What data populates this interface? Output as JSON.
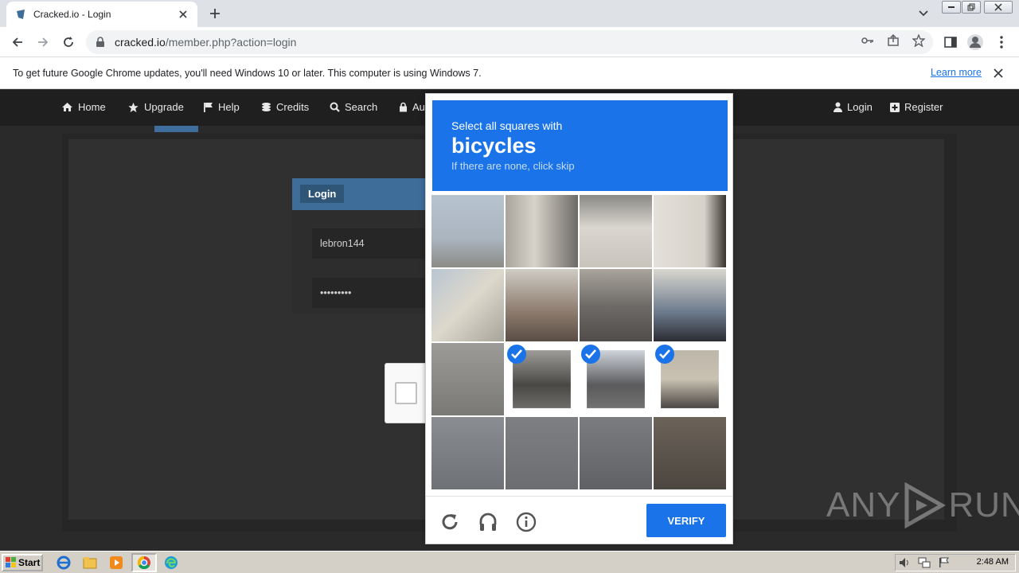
{
  "browser": {
    "tab_title": "Cracked.io - Login",
    "url_host": "cracked.io",
    "url_path": "/member.php?action=login"
  },
  "infobar": {
    "message": "To get future Google Chrome updates, you'll need Windows 10 or later. This computer is using Windows 7.",
    "learn_more": "Learn more"
  },
  "site": {
    "nav": [
      {
        "label": "Home",
        "icon": "home-icon"
      },
      {
        "label": "Upgrade",
        "icon": "star-icon"
      },
      {
        "label": "Help",
        "icon": "flag-icon"
      },
      {
        "label": "Credits",
        "icon": "coins-icon"
      },
      {
        "label": "Search",
        "icon": "search-icon"
      },
      {
        "label": "Au",
        "icon": "lock-icon"
      }
    ],
    "nav_right": [
      {
        "label": "Login",
        "icon": "user-icon"
      },
      {
        "label": "Register",
        "icon": "plus-square-icon"
      }
    ],
    "login_title": "Login",
    "username_value": "lebron144",
    "password_value": "•••••••••"
  },
  "captcha": {
    "instruction": "Select all squares with",
    "target": "bicycles",
    "hint": "If there are none, click skip",
    "selected_tiles": [
      9,
      10,
      11
    ],
    "verify_label": "VERIFY",
    "accent": "#1a73e8"
  },
  "watermark": {
    "left": "ANY",
    "right": "RUN"
  },
  "taskbar": {
    "start_label": "Start",
    "clock": "2:48 AM"
  }
}
